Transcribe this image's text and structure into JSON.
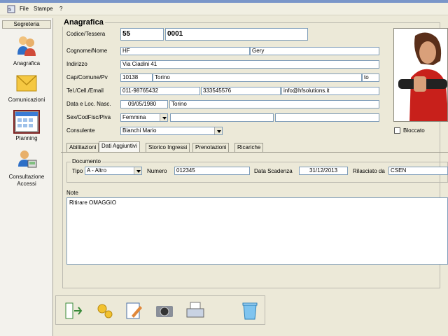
{
  "menu": {
    "items": [
      "File",
      "Stampe",
      "?"
    ]
  },
  "sidebar": {
    "title": "Segreteria",
    "items": [
      {
        "label": "Anagrafica",
        "icon": "users-icon"
      },
      {
        "label": "Comunicazioni",
        "icon": "envelope-icon"
      },
      {
        "label": "Planning",
        "icon": "calendar-icon"
      },
      {
        "label": "Consultazione Accessi",
        "icon": "access-terminal-icon"
      }
    ]
  },
  "anagrafica": {
    "title": "Anagrafica",
    "codice_label": "Codice/Tessera",
    "codice_prefix": "55",
    "codice_num": "0001",
    "cognome_label": "Cognome/Nome",
    "cognome": "HF",
    "nome": "Gery",
    "indirizzo_label": "Indirizzo",
    "indirizzo": "Via Ciadini 41",
    "cap_label": "Cap/Comune/Pv",
    "cap": "10138",
    "comune": "Torino",
    "provincia": "to",
    "tel_label": "Tel./Cell./Email",
    "tel": "011-98765432",
    "cell": "333545576",
    "email": "info@hfsolutions.it",
    "nascita_label": "Data e Loc. Nasc.",
    "data_nascita": "09/05/1980",
    "loc_nascita": "Torino",
    "sex_label": "Sex/CodFisc/Piva",
    "sesso": "Femmina",
    "codfisc": "",
    "piva": "",
    "consulente_label": "Consulente",
    "consulente": "Bianchi Mario",
    "bloccato_label": "Bloccato"
  },
  "tabs": [
    "Abilitazioni",
    "Dati Aggiuntivi",
    "Storico Ingressi",
    "Prenotazioni",
    "Ricariche"
  ],
  "documento": {
    "title": "Documento",
    "tipo_label": "Tipo",
    "tipo": "A - Altro",
    "numero_label": "Numero",
    "numero": "012345",
    "scadenza_label": "Data Scadenza",
    "scadenza": "31/12/2013",
    "rilasciato_label": "Rilasciato da",
    "rilasciato": "CSEN"
  },
  "note": {
    "label": "Note",
    "text": "Ritirare OMAGGIO"
  },
  "toolbar": {
    "buttons": [
      "exit-icon",
      "settings-icon",
      "edit-icon",
      "camera-icon",
      "print-icon",
      "trash-icon"
    ]
  }
}
